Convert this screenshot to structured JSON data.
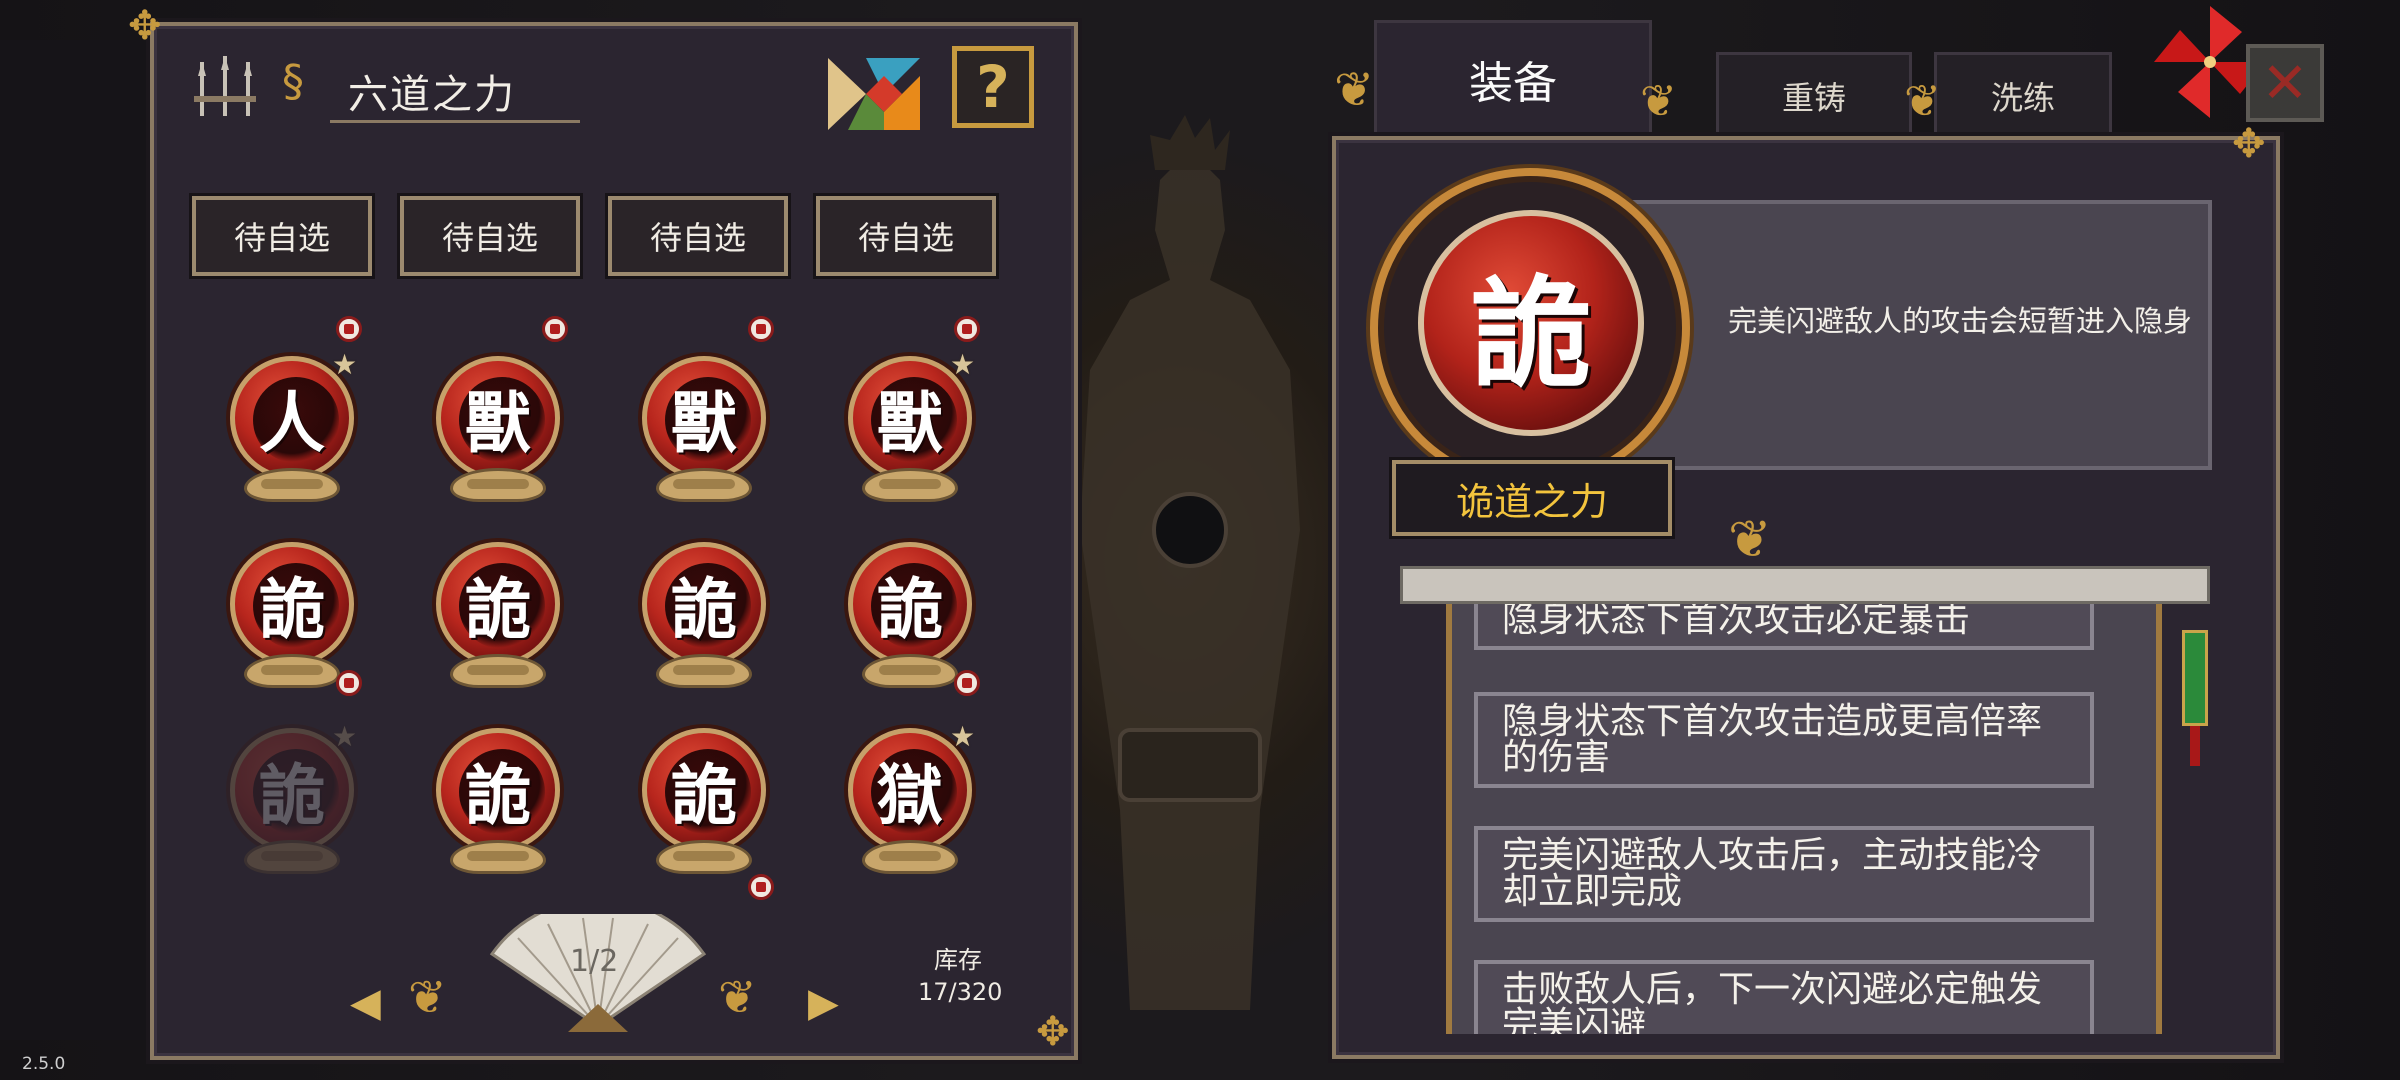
{
  "version": "2.5.0",
  "left_panel": {
    "title": "六道之力",
    "slots": [
      "待自选",
      "待自选",
      "待自选",
      "待自选"
    ],
    "orbs": [
      {
        "glyph": "人",
        "badge": true,
        "star": true,
        "faded": false
      },
      {
        "glyph": "獸",
        "badge": true,
        "star": false,
        "faded": false
      },
      {
        "glyph": "獸",
        "badge": true,
        "star": false,
        "faded": false
      },
      {
        "glyph": "獸",
        "badge": true,
        "star": true,
        "faded": false
      },
      {
        "glyph": "詭",
        "badge": true,
        "star": false,
        "faded": false
      },
      {
        "glyph": "詭",
        "badge": false,
        "star": false,
        "faded": false
      },
      {
        "glyph": "詭",
        "badge": false,
        "star": false,
        "faded": false
      },
      {
        "glyph": "詭",
        "badge": true,
        "star": false,
        "faded": false
      },
      {
        "glyph": "詭",
        "badge": false,
        "star": true,
        "faded": true
      },
      {
        "glyph": "詭",
        "badge": false,
        "star": false,
        "faded": false
      },
      {
        "glyph": "詭",
        "badge": true,
        "star": false,
        "faded": false
      },
      {
        "glyph": "獄",
        "badge": false,
        "star": true,
        "faded": false
      }
    ],
    "page": "1/2",
    "stock_label": "库存",
    "stock_value": "17/320"
  },
  "right_panel": {
    "tabs": [
      "装备",
      "重铸",
      "洗练"
    ],
    "active_tab": 0,
    "selected_glyph": "詭",
    "description": "完美闪避敌人的攻击会短暂进入隐身",
    "name": "诡道之力",
    "effects": [
      "隐身状态下首次攻击必定暴击",
      "隐身状态下首次攻击造成更高倍率的伤害",
      "完美闪避敌人攻击后，主动技能冷却立即完成",
      "击败敌人后，下一次闪避必定触发完美闪避"
    ]
  },
  "colors": {
    "accent_gold": "#c79a3f",
    "name_yellow": "#f3c43d",
    "orb_red": "#b2231a"
  }
}
